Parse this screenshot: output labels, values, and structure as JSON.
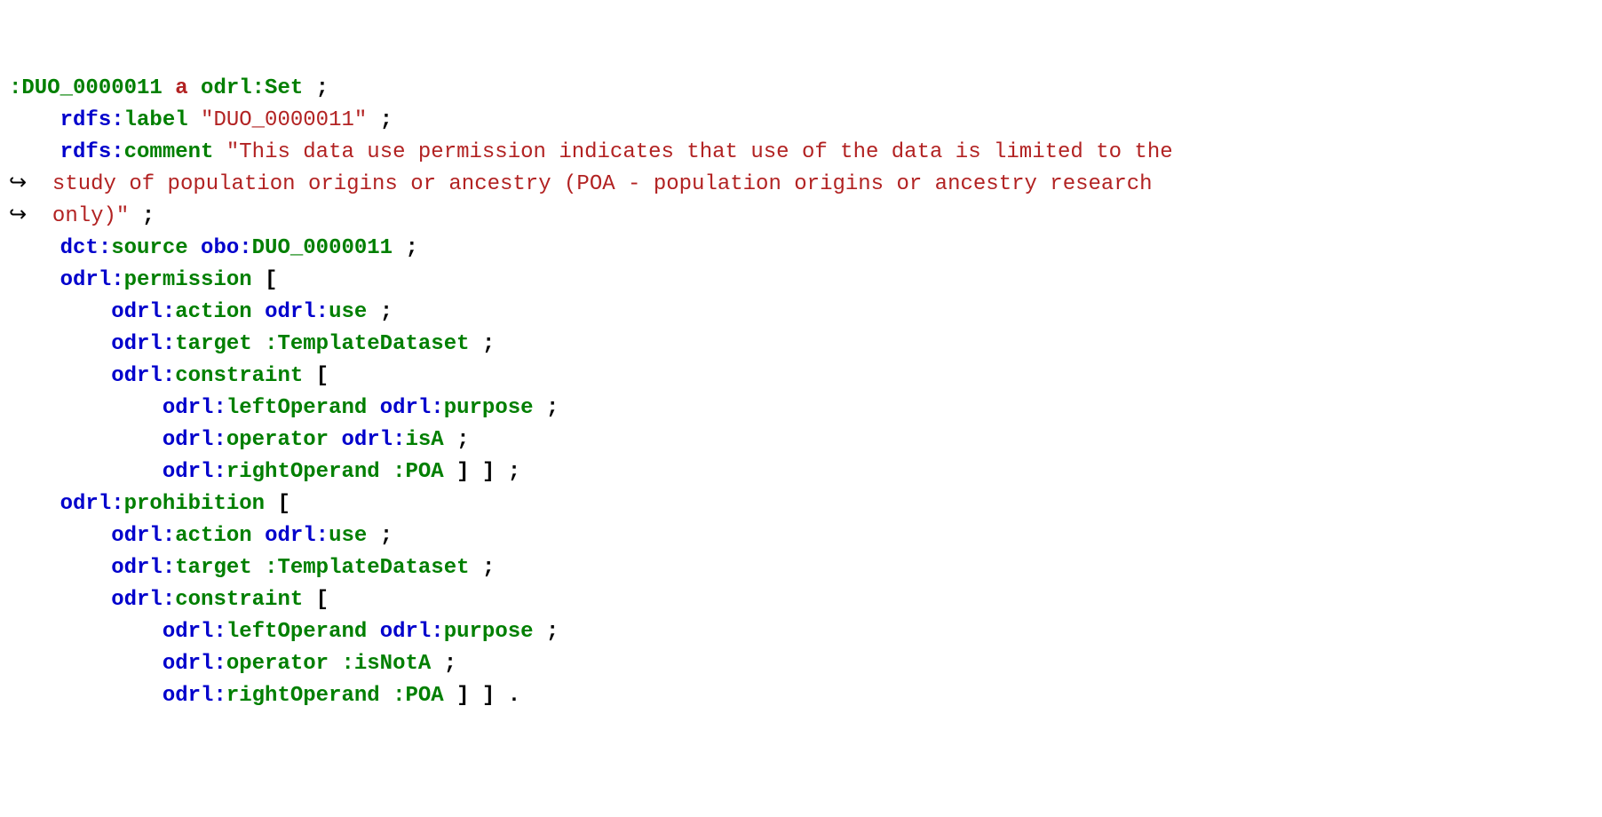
{
  "line1": {
    "subject": ":DUO_0000011",
    "a": "a",
    "class": "odrl:Set",
    "semi": " ;"
  },
  "line2": {
    "prefix": "rdfs:",
    "name": "label",
    "value": "\"DUO_0000011\"",
    "semi": " ;"
  },
  "line3": {
    "prefix": "rdfs:",
    "name": "comment",
    "value": "\"This data use permission indicates that use of the data is limited to the"
  },
  "line4": {
    "arrow": "↪  ",
    "value": "study of population origins or ancestry (POA - population origins or ancestry research"
  },
  "line5": {
    "arrow": "↪  ",
    "value": "only)\"",
    "semi": " ;"
  },
  "line6": {
    "prefix": "dct:",
    "name": "source",
    "objprefix": "obo:",
    "objname": "DUO_0000011",
    "semi": " ;"
  },
  "line7": {
    "prefix": "odrl:",
    "name": "permission",
    "bracket": " ["
  },
  "line8": {
    "prefix": "odrl:",
    "name": "action",
    "objprefix": "odrl:",
    "objname": "use",
    "semi": " ;"
  },
  "line9": {
    "prefix": "odrl:",
    "name": "target",
    "obj": ":TemplateDataset",
    "semi": " ;"
  },
  "line10": {
    "prefix": "odrl:",
    "name": "constraint",
    "bracket": " ["
  },
  "line11": {
    "prefix": "odrl:",
    "name": "leftOperand",
    "objprefix": "odrl:",
    "objname": "purpose",
    "semi": " ;"
  },
  "line12": {
    "prefix": "odrl:",
    "name": "operator",
    "objprefix": "odrl:",
    "objname": "isA",
    "semi": " ;"
  },
  "line13": {
    "prefix": "odrl:",
    "name": "rightOperand",
    "obj": ":POA",
    "close": " ] ] ;"
  },
  "line14": {
    "prefix": "odrl:",
    "name": "prohibition",
    "bracket": " ["
  },
  "line15": {
    "prefix": "odrl:",
    "name": "action",
    "objprefix": "odrl:",
    "objname": "use",
    "semi": " ;"
  },
  "line16": {
    "prefix": "odrl:",
    "name": "target",
    "obj": ":TemplateDataset",
    "semi": " ;"
  },
  "line17": {
    "prefix": "odrl:",
    "name": "constraint",
    "bracket": " ["
  },
  "line18": {
    "prefix": "odrl:",
    "name": "leftOperand",
    "objprefix": "odrl:",
    "objname": "purpose",
    "semi": " ;"
  },
  "line19": {
    "prefix": "odrl:",
    "name": "operator",
    "obj": ":isNotA",
    "semi": " ;"
  },
  "line20": {
    "prefix": "odrl:",
    "name": "rightOperand",
    "obj": ":POA",
    "close": " ] ] ."
  }
}
